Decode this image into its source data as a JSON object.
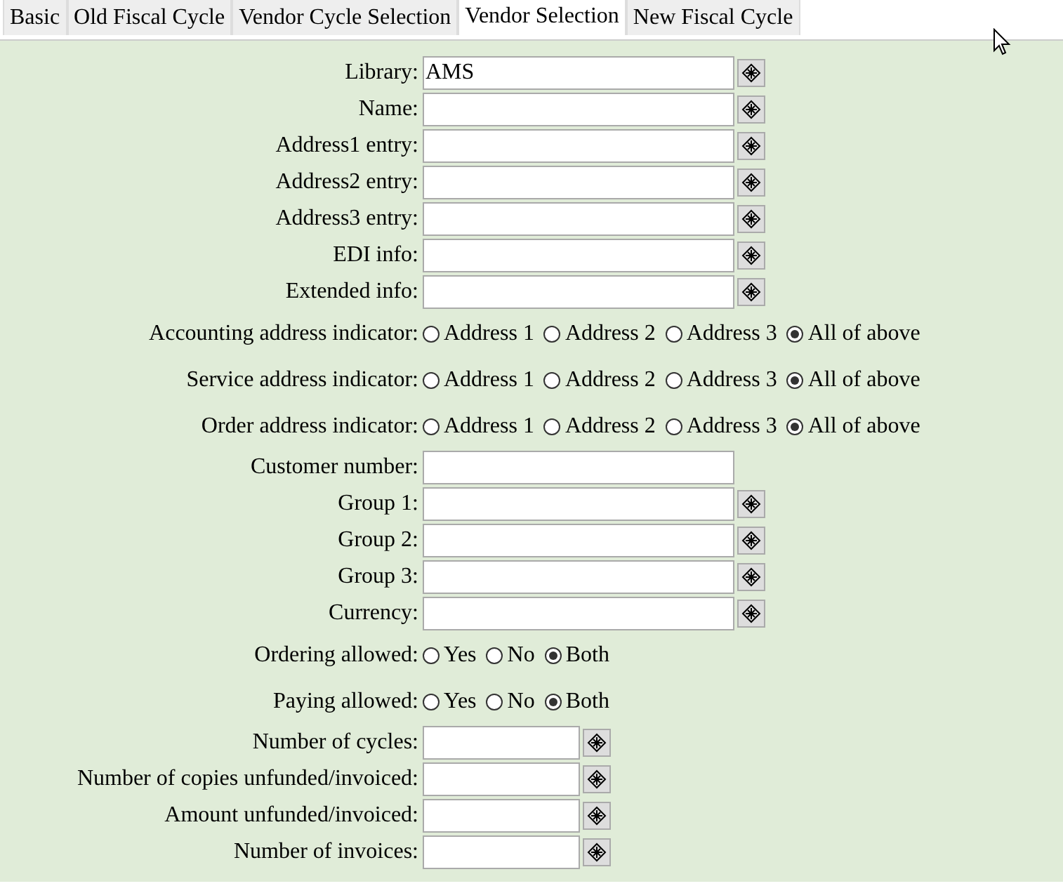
{
  "tabs": [
    {
      "label": "Basic",
      "selected": false
    },
    {
      "label": "Old Fiscal Cycle",
      "selected": false
    },
    {
      "label": "Vendor Cycle Selection",
      "selected": false
    },
    {
      "label": "Vendor Selection",
      "selected": true
    },
    {
      "label": "New Fiscal Cycle",
      "selected": false
    }
  ],
  "form": [
    {
      "kind": "lookup-field",
      "label": "Library:",
      "value": "AMS"
    },
    {
      "kind": "lookup-field",
      "label": "Name:"
    },
    {
      "kind": "lookup-field",
      "label": "Address1 entry:"
    },
    {
      "kind": "lookup-field",
      "label": "Address2 entry:"
    },
    {
      "kind": "lookup-field",
      "label": "Address3 entry:"
    },
    {
      "kind": "lookup-field",
      "label": "EDI info:"
    },
    {
      "kind": "lookup-field",
      "label": "Extended info:"
    },
    {
      "kind": "radio",
      "label": "Accounting address indicator:",
      "options": [
        {
          "label": "Address 1",
          "selected": false
        },
        {
          "label": "Address 2",
          "selected": false
        },
        {
          "label": "Address 3",
          "selected": false
        },
        {
          "label": "All of above",
          "selected": true
        }
      ]
    },
    {
      "kind": "radio",
      "label": "Service address indicator:",
      "options": [
        {
          "label": "Address 1",
          "selected": false
        },
        {
          "label": "Address 2",
          "selected": false
        },
        {
          "label": "Address 3",
          "selected": false
        },
        {
          "label": "All of above",
          "selected": true
        }
      ]
    },
    {
      "kind": "radio",
      "label": "Order address indicator:",
      "options": [
        {
          "label": "Address 1",
          "selected": false
        },
        {
          "label": "Address 2",
          "selected": false
        },
        {
          "label": "Address 3",
          "selected": false
        },
        {
          "label": "All of above",
          "selected": true
        }
      ]
    },
    {
      "kind": "plain-field",
      "label": "Customer number:"
    },
    {
      "kind": "lookup-field",
      "label": "Group 1:"
    },
    {
      "kind": "lookup-field",
      "label": "Group 2:"
    },
    {
      "kind": "lookup-field",
      "label": "Group 3:"
    },
    {
      "kind": "lookup-field",
      "label": "Currency:"
    },
    {
      "kind": "radio",
      "label": "Ordering allowed:",
      "options": [
        {
          "label": "Yes",
          "selected": false
        },
        {
          "label": "No",
          "selected": false
        },
        {
          "label": "Both",
          "selected": true
        }
      ]
    },
    {
      "kind": "radio",
      "label": "Paying allowed:",
      "options": [
        {
          "label": "Yes",
          "selected": false
        },
        {
          "label": "No",
          "selected": false
        },
        {
          "label": "Both",
          "selected": true
        }
      ]
    },
    {
      "kind": "short-lookup-field",
      "label": "Number of cycles:"
    },
    {
      "kind": "short-lookup-field",
      "label": "Number of copies unfunded/invoiced:"
    },
    {
      "kind": "short-lookup-field",
      "label": "Amount unfunded/invoiced:"
    },
    {
      "kind": "short-lookup-field",
      "label": "Number of invoices:"
    }
  ]
}
